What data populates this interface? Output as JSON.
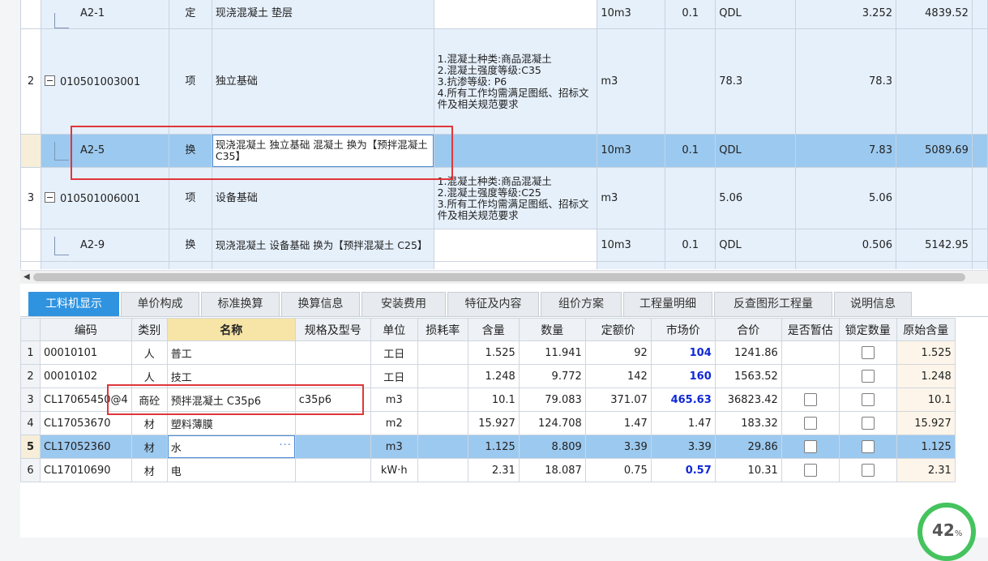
{
  "upper": {
    "rows": [
      {
        "idx": "",
        "code": "A2-1",
        "type": "定",
        "name": "现浇混凝土 垫层",
        "feature": "",
        "unit": "10m3",
        "coef": "0.1",
        "expr": "QDL",
        "qty": "3.252",
        "price": "4839.52"
      },
      {
        "idx": "2",
        "code": "010501003001",
        "type": "项",
        "name": "独立基础",
        "feature": "1.混凝土种类:商品混凝土\n2.混凝土强度等级:C35\n3.抗渗等级: P6\n4.所有工作均需满足图纸、招标文件及相关规范要求",
        "unit": "m3",
        "coef": "",
        "expr": "78.3",
        "qty": "78.3",
        "price": ""
      },
      {
        "idx": "",
        "code": "A2-5",
        "type": "换",
        "name": "现浇混凝土 独立基础 混凝土  换为【预拌混凝土 C35】",
        "feature": "",
        "unit": "10m3",
        "coef": "0.1",
        "expr": "QDL",
        "qty": "7.83",
        "price": "5089.69"
      },
      {
        "idx": "3",
        "code": "010501006001",
        "type": "项",
        "name": "设备基础",
        "feature": "1.混凝土种类:商品混凝土\n2.混凝土强度等级:C25\n3.所有工作均需满足图纸、招标文件及相关规范要求",
        "unit": "m3",
        "coef": "",
        "expr": "5.06",
        "qty": "5.06",
        "price": ""
      },
      {
        "idx": "",
        "code": "A2-9",
        "type": "换",
        "name": "现浇混凝土 设备基础  换为【预拌混凝土 C25】",
        "feature": "",
        "unit": "10m3",
        "coef": "0.1",
        "expr": "QDL",
        "qty": "0.506",
        "price": "5142.95"
      }
    ]
  },
  "tabs": [
    "工料机显示",
    "单价构成",
    "标准换算",
    "换算信息",
    "安装费用",
    "特征及内容",
    "组价方案",
    "工程量明细",
    "反查图形工程量",
    "说明信息"
  ],
  "lower": {
    "headers": [
      "编码",
      "类别",
      "名称",
      "规格及型号",
      "单位",
      "损耗率",
      "含量",
      "数量",
      "定额价",
      "市场价",
      "合价",
      "是否暂估",
      "锁定数量",
      "原始含量"
    ],
    "rows": [
      {
        "idx": "1",
        "code": "00010101",
        "cat": "人",
        "name": "普工",
        "spec": "",
        "unit": "工日",
        "loss": "",
        "content": "1.525",
        "qty": "11.941",
        "base": "92",
        "market": "104",
        "total": "1241.86",
        "orig": "1.525"
      },
      {
        "idx": "2",
        "code": "00010102",
        "cat": "人",
        "name": "技工",
        "spec": "",
        "unit": "工日",
        "loss": "",
        "content": "1.248",
        "qty": "9.772",
        "base": "142",
        "market": "160",
        "total": "1563.52",
        "orig": "1.248"
      },
      {
        "idx": "3",
        "code": "CL17065450@4",
        "cat": "商砼",
        "name": "预拌混凝土 C35p6",
        "spec": "c35p6",
        "unit": "m3",
        "loss": "",
        "content": "10.1",
        "qty": "79.083",
        "base": "371.07",
        "market": "465.63",
        "total": "36823.42",
        "orig": "10.1"
      },
      {
        "idx": "4",
        "code": "CL17053670",
        "cat": "材",
        "name": "塑料薄膜",
        "spec": "",
        "unit": "m2",
        "loss": "",
        "content": "15.927",
        "qty": "124.708",
        "base": "1.47",
        "market": "1.47",
        "total": "183.32",
        "orig": "15.927"
      },
      {
        "idx": "5",
        "code": "CL17052360",
        "cat": "材",
        "name": "水",
        "spec": "",
        "unit": "m3",
        "loss": "",
        "content": "1.125",
        "qty": "8.809",
        "base": "3.39",
        "market": "3.39",
        "total": "29.86",
        "orig": "1.125"
      },
      {
        "idx": "6",
        "code": "CL17010690",
        "cat": "材",
        "name": "电",
        "spec": "",
        "unit": "kW·h",
        "loss": "",
        "content": "2.31",
        "qty": "18.087",
        "base": "0.75",
        "market": "0.57",
        "total": "10.31",
        "orig": "2.31"
      }
    ],
    "more_label": "···"
  },
  "gauge": {
    "value": "42",
    "unit": "%"
  },
  "colors": {
    "accent": "#2f93e0",
    "selected": "#9cc9ef",
    "highlight": "#e0363a",
    "market_blue": "#1028d6"
  }
}
